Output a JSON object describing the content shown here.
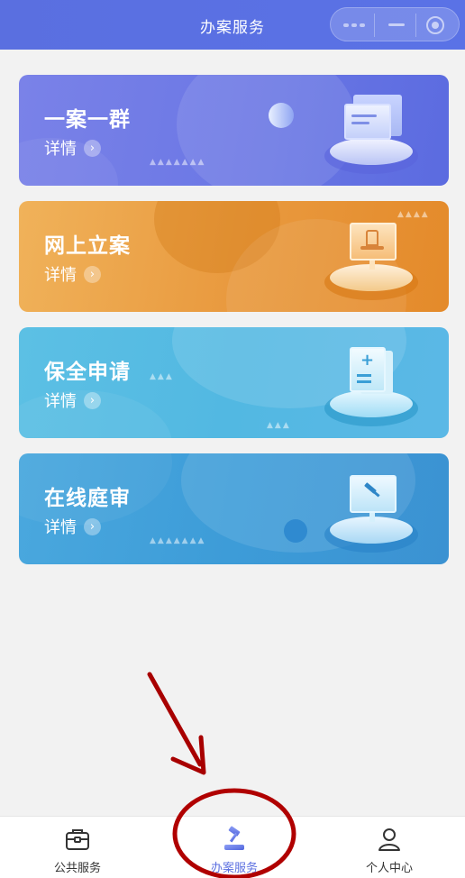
{
  "header": {
    "title": "办案服务"
  },
  "cards": [
    {
      "title": "一案一群",
      "detail": "详情"
    },
    {
      "title": "网上立案",
      "detail": "详情"
    },
    {
      "title": "保全申请",
      "detail": "详情"
    },
    {
      "title": "在线庭审",
      "detail": "详情"
    }
  ],
  "tabbar": {
    "items": [
      {
        "label": "公共服务",
        "icon": "briefcase-icon"
      },
      {
        "label": "办案服务",
        "icon": "gavel-icon",
        "active": true
      },
      {
        "label": "个人中心",
        "icon": "user-icon"
      }
    ]
  },
  "colors": {
    "header": "#5a6fe0",
    "card1": "#6c78e5",
    "card2": "#e99a3f",
    "card3": "#52b8e2",
    "card4": "#3d9cd8",
    "annotation": "#b00000"
  }
}
